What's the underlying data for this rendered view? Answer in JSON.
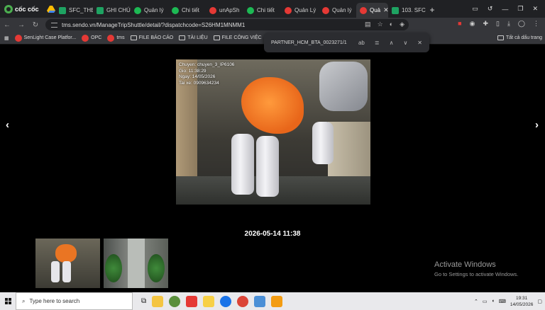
{
  "browser": {
    "brand": "cốc cốc",
    "tabs": [
      {
        "label": "SFC_THE",
        "favicon": "sheets-icon",
        "active": false
      },
      {
        "label": "GHI CHÚ",
        "favicon": "sheets-icon",
        "active": false
      },
      {
        "label": "Quản lý",
        "favicon": "spotify-icon",
        "active": false
      },
      {
        "label": "Chi tiết",
        "favicon": "spotify-icon",
        "active": false
      },
      {
        "label": "unApSh",
        "favicon": "sendo-icon",
        "active": false
      },
      {
        "label": "Chi tiết",
        "favicon": "spotify-icon",
        "active": false
      },
      {
        "label": "Quản Lý",
        "favicon": "sendo-icon",
        "active": false
      },
      {
        "label": "Quản lý",
        "favicon": "sendo-icon",
        "active": false
      },
      {
        "label": "Quả",
        "favicon": "sendo-icon",
        "active": true
      },
      {
        "label": "103. SFC",
        "favicon": "sheets-icon",
        "active": false
      }
    ],
    "url": "tms.sendo.vn/ManageTripShuttle/detail/?dispatchcode=S26HM1MNMM1",
    "bookmarks": [
      {
        "label": "SenLight Case Platfor..."
      },
      {
        "label": "OPC"
      },
      {
        "label": "tms"
      },
      {
        "label": "FILE BÁO CÁO"
      },
      {
        "label": "TÀI LIỆU"
      },
      {
        "label": "FILE CÔNG VIỆC"
      }
    ],
    "bookmarks_right": "Tất cả dấu trang",
    "findbar": {
      "query": "PARTNER_HCM_BTA_002327",
      "count": "1/1"
    }
  },
  "viewer": {
    "overlay": {
      "line1": "Chuyen: chuyen_3_IP6106",
      "line2": "Gio: 11:38:29",
      "line3": "Ngay: 14/05/2026",
      "line4": "Tai xe: 0909634234"
    },
    "timestamp": "2026-05-14 11:38",
    "prev": "‹",
    "next": "›"
  },
  "watermark": {
    "title": "Activate Windows",
    "subtitle": "Go to Settings to activate Windows."
  },
  "taskbar": {
    "search_placeholder": "Type here to search",
    "time": "19:31",
    "date": "14/05/2026"
  },
  "colors": {
    "accent_red": "#e53935",
    "sheets_green": "#1ea362",
    "orange": "#ea7523"
  }
}
